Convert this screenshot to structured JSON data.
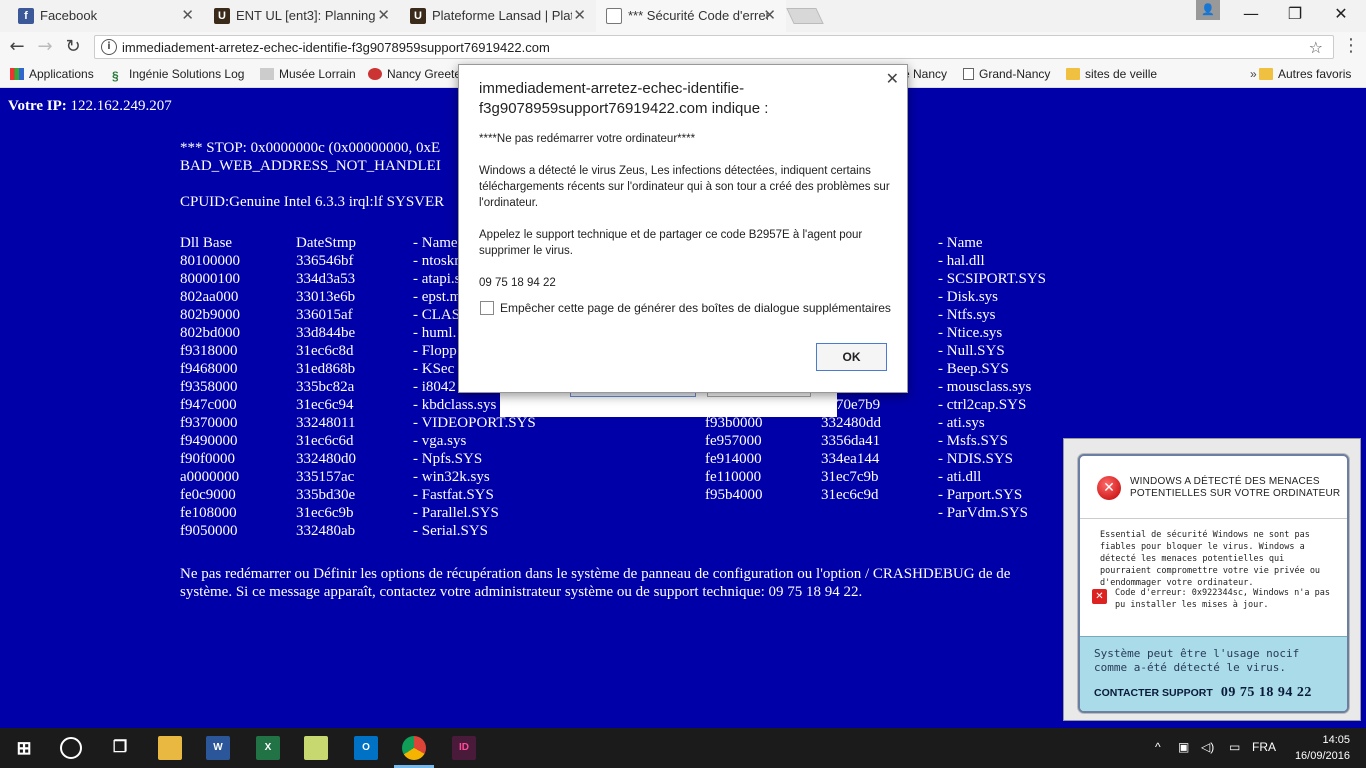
{
  "tabs": [
    {
      "title": "Facebook",
      "icon": "facebook-icon",
      "color": "#3b5998",
      "glyph": "f"
    },
    {
      "title": "ENT UL [ent3]: Planning U",
      "icon": "ul-icon",
      "color": "#3a2a1a",
      "glyph": "U"
    },
    {
      "title": "Plateforme Lansad | Plate",
      "icon": "ul-icon",
      "color": "#3a2a1a",
      "glyph": "U"
    },
    {
      "title": "*** Sécurité Code d'erreu",
      "icon": "page-icon",
      "color": "#ffffff",
      "glyph": ""
    }
  ],
  "address_bar": {
    "url": "immediadement-arretez-echec-identifie-f3g9078959support76919422.com"
  },
  "bookmarks": [
    {
      "label": "Applications",
      "icon": "apps-icon"
    },
    {
      "label": "Ingénie  Solutions Log",
      "icon": "solutions-icon"
    },
    {
      "label": "Musée Lorrain",
      "icon": "museum-icon"
    },
    {
      "label": "Nancy Greete",
      "icon": "greeter-icon"
    },
    {
      "label": "e Nancy",
      "icon": ""
    },
    {
      "label": "Grand-Nancy",
      "icon": "page-icon"
    },
    {
      "label": "sites de veille",
      "icon": "folder-icon"
    },
    {
      "label": "Autres favoris",
      "icon": "folder-icon"
    }
  ],
  "page": {
    "ip_label": "Votre IP:",
    "ip_value": "122.162.249.207",
    "stop_line1": "*** STOP: 0x0000000c (0x00000000, 0xE",
    "stop_line2": "BAD_WEB_ADDRESS_NOT_HANDLEI",
    "cpuid": "CPUID:Genuine Intel 6.3.3 irql:lf SYSVER",
    "table_headers": [
      "Dll Base",
      "DateStmp",
      "- Name",
      "- Name"
    ],
    "left_rows": [
      [
        "80100000",
        "336546bf",
        "- ntoskr"
      ],
      [
        "80000100",
        "334d3a53",
        "- atapi.s"
      ],
      [
        "802aa000",
        "33013e6b",
        "- epst.m"
      ],
      [
        "802b9000",
        "336015af",
        "- CLAS"
      ],
      [
        "802bd000",
        "33d844be",
        "- huml."
      ],
      [
        "f9318000",
        "31ec6c8d",
        "- Flopp"
      ],
      [
        "f9468000",
        "31ed868b",
        "- KSec"
      ],
      [
        "f9358000",
        "335bc82a",
        "- i8042"
      ],
      [
        "f947c000",
        "31ec6c94",
        "- kbdclass.sys"
      ],
      [
        "f9370000",
        "33248011",
        "- VIDEOPORT.SYS"
      ],
      [
        "f9490000",
        "31ec6c6d",
        "- vga.sys"
      ],
      [
        "f90f0000",
        "332480d0",
        "- Npfs.SYS"
      ],
      [
        "a0000000",
        "335157ac",
        "- win32k.sys"
      ],
      [
        "fe0c9000",
        "335bd30e",
        "- Fastfat.SYS"
      ],
      [
        "fe108000",
        "31ec6c9b",
        "- Parallel.SYS"
      ],
      [
        "f9050000",
        "332480ab",
        "- Serial.SYS"
      ]
    ],
    "right_names": [
      "- hal.dll",
      "- SCSIPORT.SYS",
      "- Disk.sys",
      "- Ntfs.sys",
      "- Ntice.sys",
      "- Null.SYS",
      "- Beep.SYS",
      "- mousclass.sys",
      "- ctrl2cap.SYS",
      "- ati.sys",
      "- Msfs.SYS",
      "- NDIS.SYS",
      "- ati.dll",
      "- Parport.SYS",
      "- ParVdm.SYS"
    ],
    "mid_rows": [
      {
        "row": 8,
        "base": "",
        "stamp": "9d"
      },
      {
        "row": 9,
        "base": "fe9d7000",
        "stamp": "3370e7b9"
      },
      {
        "row": 10,
        "base": "f93b0000",
        "stamp": "332480dd"
      },
      {
        "row": 11,
        "base": "fe957000",
        "stamp": "3356da41"
      },
      {
        "row": 12,
        "base": "fe914000",
        "stamp": "334ea144"
      },
      {
        "row": 13,
        "base": "fe110000",
        "stamp": "31ec7c9b"
      },
      {
        "row": 14,
        "base": "f95b4000",
        "stamp": "31ec6c9d"
      }
    ],
    "footer_line1": "Ne pas redémarrer ou Définir les options de récupération dans le système de panneau de configuration ou l'option / CRASHDEBUG de de",
    "footer_line2": "système. Si ce message apparaît, contactez votre administrateur système ou de support technique: 09 75 18 94 22."
  },
  "alert": {
    "header": "immediadement-arretez-echec-identifie-f3g9078959support76919422.com indique :",
    "line1": "****Ne pas redémarrer votre ordinateur****",
    "line2": " Windows a détecté le virus Zeus, Les infections détectées, indiquent certains téléchargements récents sur l'ordinateur qui à son tour a créé des problèmes sur l'ordinateur.",
    "line3": " Appelez le support technique et de partager ce code B2957E à l'agent pour supprimer le virus.",
    "line4": " 09 75 18 94 22",
    "checkbox_label": "Empêcher cette page de générer des boîtes de dialogue supplémentaires",
    "ok_label": "OK"
  },
  "popup": {
    "title": "WINDOWS A DÉTECTÉ DES MENACES POTENTIELLES SUR VOTRE ORDINATEUR",
    "body": "Essential de sécurité Windows ne sont pas fiables pour bloquer le virus. Windows a détecté les menaces potentielles qui pourraient compromettre votre vie privée ou d'endommager votre ordinateur.",
    "code_text": "Code d'erreur: 0x922344sc, Windows n'a pas pu installer les mises à jour.",
    "cta_text": "Système peut être l'usage nocif comme a-été détecté le virus.",
    "cta_label": "CONTACTER SUPPORT",
    "phone": "09 75 18 94 22"
  },
  "taskbar": {
    "lang": "FRA",
    "time": "14:05",
    "date": "16/09/2016"
  },
  "colors": {
    "bsod_blue": "#0000a8",
    "popup_cta": "#a9dce8"
  }
}
